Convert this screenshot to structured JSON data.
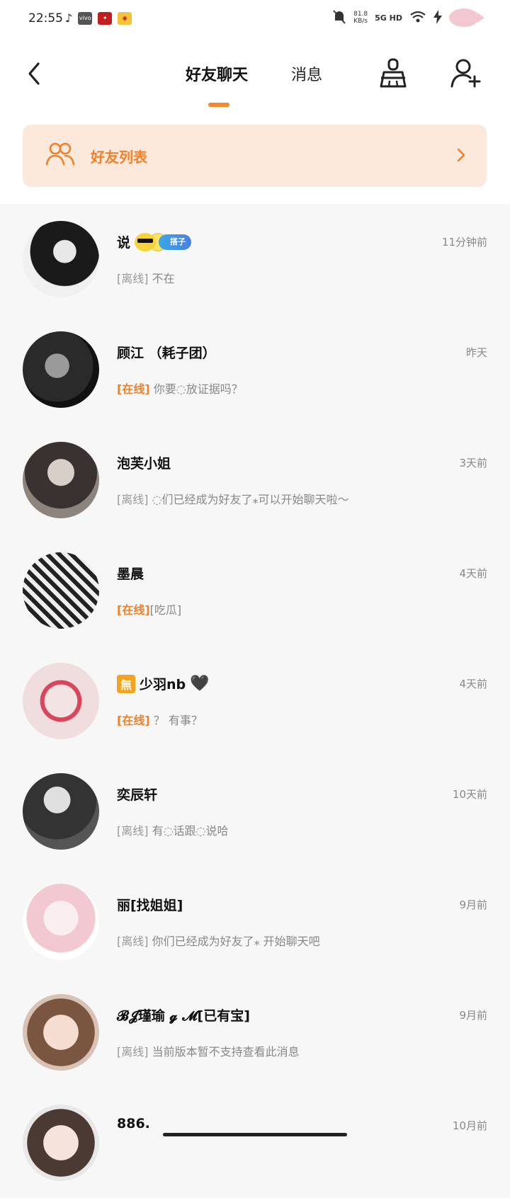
{
  "status_bar": {
    "time": "22:55",
    "speed_top": "81.8",
    "speed_unit": "KB/s",
    "network": "5G HD"
  },
  "nav": {
    "tab_friends": "好友聊天",
    "tab_messages": "消息"
  },
  "banner": {
    "label": "好友列表"
  },
  "accent_color": "#f28a2e",
  "conversations": [
    {
      "name": "说",
      "tag": "搭子",
      "status": "[离线]",
      "online": false,
      "message": "不在",
      "time": "11分钟前"
    },
    {
      "name": "顾江 （耗子团）",
      "status": "[在线]",
      "online": true,
      "message": "你要◌放证据吗？",
      "time": "昨天"
    },
    {
      "name": "泡芙小姐",
      "status": "[离线]",
      "online": false,
      "message": "◌们已经成为好友了⁎可以开始聊天啦～",
      "time": "3天前"
    },
    {
      "name": "墨晨",
      "status": "[在线]",
      "online": true,
      "message": "[吃瓜]",
      "time": "4天前"
    },
    {
      "name": "少羽nb",
      "prefix": "無",
      "suffix": "🖤",
      "status": "[在线]",
      "online": true,
      "message": "？ 有事？",
      "time": "4天前"
    },
    {
      "name": "奕辰轩",
      "status": "[离线]",
      "online": false,
      "message": "有◌话跟◌说哈",
      "time": "10天前"
    },
    {
      "name": "丽[找姐姐]",
      "status": "[离线]",
      "online": false,
      "message": "你们已经成为好友了⁎ 开始聊天吧",
      "time": "9月前"
    },
    {
      "name": "𝓑𝓙瑾瑜 𝓰 𝓜[已有宝]",
      "status": "[离线]",
      "online": false,
      "message": "当前版本暂不支持查看此消息",
      "time": "9月前"
    },
    {
      "name": "886.",
      "status": "",
      "online": false,
      "message": "",
      "time": "10月前"
    }
  ]
}
